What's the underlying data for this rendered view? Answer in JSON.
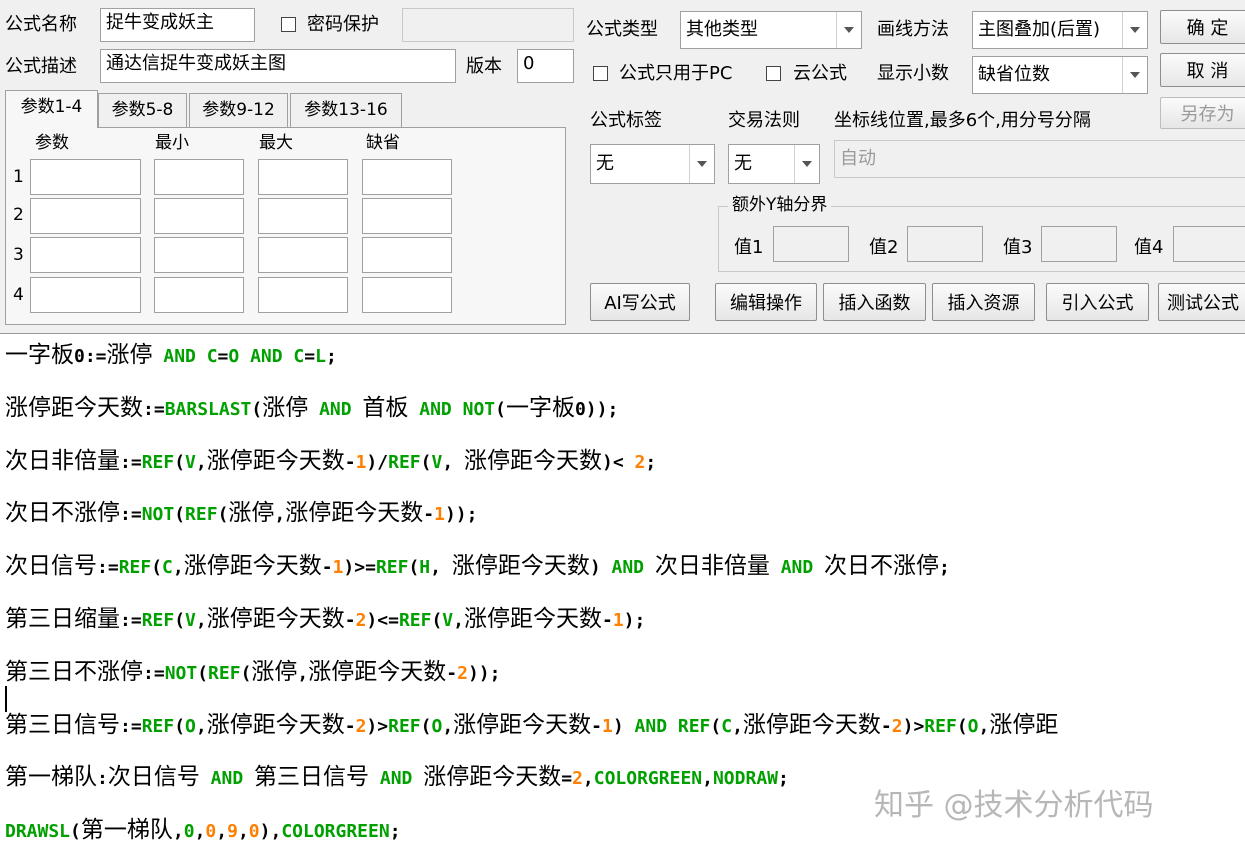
{
  "form": {
    "name_label": "公式名称",
    "name_value": "捉牛变成妖主",
    "pwd_label": "密码保护",
    "desc_label": "公式描述",
    "desc_value": "通达信捉牛变成妖主图",
    "version_label": "版本",
    "version_value": "0",
    "type_label": "公式类型",
    "type_value": "其他类型",
    "draw_label": "画线方法",
    "draw_value": "主图叠加(后置)",
    "pc_only_label": "公式只用于PC",
    "cloud_label": "云公式",
    "decimal_label": "显示小数",
    "decimal_value": "缺省位数",
    "tag_label": "公式标签",
    "tag_value": "无",
    "trade_label": "交易法则",
    "trade_value": "无",
    "axis_label": "坐标线位置,最多6个,用分号分隔",
    "axis_value": "自动",
    "yaxis_group": "额外Y轴分界",
    "v1": "值1",
    "v2": "值2",
    "v3": "值3",
    "v4": "值4"
  },
  "buttons": {
    "ok": "确 定",
    "cancel": "取 消",
    "save_as": "另存为",
    "ai": "AI写公式",
    "edit": "编辑操作",
    "insert_fn": "插入函数",
    "insert_res": "插入资源",
    "import": "引入公式",
    "test": "测试公式"
  },
  "tabs": [
    "参数1-4",
    "参数5-8",
    "参数9-12",
    "参数13-16"
  ],
  "params": {
    "headers": [
      "参数",
      "最小",
      "最大",
      "缺省"
    ],
    "rows": [
      "1",
      "2",
      "3",
      "4"
    ]
  },
  "code": [
    [
      [
        "c",
        "一字板"
      ],
      [
        "o",
        "0:="
      ],
      [
        "c",
        "涨停"
      ],
      [
        "f",
        " AND "
      ],
      [
        "f",
        "C"
      ],
      [
        "o",
        "="
      ],
      [
        "f",
        "O"
      ],
      [
        "f",
        " AND "
      ],
      [
        "f",
        "C"
      ],
      [
        "o",
        "="
      ],
      [
        "f",
        "L"
      ],
      [
        "o",
        ";"
      ]
    ],
    [
      [
        "c",
        "涨停距今天数"
      ],
      [
        "o",
        ":="
      ],
      [
        "f",
        "BARSLAST"
      ],
      [
        "o",
        "("
      ],
      [
        "c",
        "涨停"
      ],
      [
        "f",
        " AND "
      ],
      [
        "c",
        "首板"
      ],
      [
        "f",
        " AND "
      ],
      [
        "f",
        "NOT"
      ],
      [
        "o",
        "("
      ],
      [
        "c",
        "一字板"
      ],
      [
        "o",
        "0));"
      ]
    ],
    [
      [
        "c",
        "次日非倍量"
      ],
      [
        "o",
        ":="
      ],
      [
        "f",
        "REF"
      ],
      [
        "o",
        "("
      ],
      [
        "f",
        "V"
      ],
      [
        "o",
        ","
      ],
      [
        "c",
        "涨停距今天数"
      ],
      [
        "o",
        "-"
      ],
      [
        "n",
        "1"
      ],
      [
        "o",
        ")/"
      ],
      [
        "f",
        "REF"
      ],
      [
        "o",
        "("
      ],
      [
        "f",
        "V"
      ],
      [
        "o",
        ", "
      ],
      [
        "c",
        "涨停距今天数"
      ],
      [
        "o",
        ")< "
      ],
      [
        "n",
        "2"
      ],
      [
        "o",
        ";"
      ]
    ],
    [
      [
        "c",
        "次日不涨停"
      ],
      [
        "o",
        ":="
      ],
      [
        "f",
        "NOT"
      ],
      [
        "o",
        "("
      ],
      [
        "f",
        "REF"
      ],
      [
        "o",
        "("
      ],
      [
        "c",
        "涨停"
      ],
      [
        "o",
        ","
      ],
      [
        "c",
        "涨停距今天数"
      ],
      [
        "o",
        "-"
      ],
      [
        "n",
        "1"
      ],
      [
        "o",
        "));"
      ]
    ],
    [
      [
        "c",
        "次日信号"
      ],
      [
        "o",
        ":="
      ],
      [
        "f",
        "REF"
      ],
      [
        "o",
        "("
      ],
      [
        "f",
        "C"
      ],
      [
        "o",
        ","
      ],
      [
        "c",
        "涨停距今天数"
      ],
      [
        "o",
        "-"
      ],
      [
        "n",
        "1"
      ],
      [
        "o",
        ")>="
      ],
      [
        "f",
        "REF"
      ],
      [
        "o",
        "("
      ],
      [
        "f",
        "H"
      ],
      [
        "o",
        ", "
      ],
      [
        "c",
        "涨停距今天数"
      ],
      [
        "o",
        ")"
      ],
      [
        "f",
        " AND "
      ],
      [
        "c",
        "次日非倍量"
      ],
      [
        "f",
        " AND "
      ],
      [
        "c",
        "次日不涨停"
      ],
      [
        "o",
        ";"
      ]
    ],
    [
      [
        "c",
        "第三日缩量"
      ],
      [
        "o",
        ":="
      ],
      [
        "f",
        "REF"
      ],
      [
        "o",
        "("
      ],
      [
        "f",
        "V"
      ],
      [
        "o",
        ","
      ],
      [
        "c",
        "涨停距今天数"
      ],
      [
        "o",
        "-"
      ],
      [
        "n",
        "2"
      ],
      [
        "o",
        ")<="
      ],
      [
        "f",
        "REF"
      ],
      [
        "o",
        "("
      ],
      [
        "f",
        "V"
      ],
      [
        "o",
        ","
      ],
      [
        "c",
        "涨停距今天数"
      ],
      [
        "o",
        "-"
      ],
      [
        "n",
        "1"
      ],
      [
        "o",
        ");"
      ]
    ],
    [
      [
        "c",
        "第三日不涨停"
      ],
      [
        "o",
        ":="
      ],
      [
        "f",
        "NOT"
      ],
      [
        "o",
        "("
      ],
      [
        "f",
        "REF"
      ],
      [
        "o",
        "("
      ],
      [
        "c",
        "涨停"
      ],
      [
        "o",
        ","
      ],
      [
        "c",
        "涨停距今天数"
      ],
      [
        "o",
        "-"
      ],
      [
        "n",
        "2"
      ],
      [
        "o",
        "));"
      ]
    ],
    [
      [
        "c",
        "第三日信号"
      ],
      [
        "o",
        ":="
      ],
      [
        "f",
        "REF"
      ],
      [
        "o",
        "("
      ],
      [
        "f",
        "O"
      ],
      [
        "o",
        ","
      ],
      [
        "c",
        "涨停距今天数"
      ],
      [
        "o",
        "-"
      ],
      [
        "n",
        "2"
      ],
      [
        "o",
        ")>"
      ],
      [
        "f",
        "REF"
      ],
      [
        "o",
        "("
      ],
      [
        "f",
        "O"
      ],
      [
        "o",
        ","
      ],
      [
        "c",
        "涨停距今天数"
      ],
      [
        "o",
        "-"
      ],
      [
        "n",
        "1"
      ],
      [
        "o",
        ")"
      ],
      [
        "f",
        " AND "
      ],
      [
        "f",
        "REF"
      ],
      [
        "o",
        "("
      ],
      [
        "f",
        "C"
      ],
      [
        "o",
        ","
      ],
      [
        "c",
        "涨停距今天数"
      ],
      [
        "o",
        "-"
      ],
      [
        "n",
        "2"
      ],
      [
        "o",
        ")>"
      ],
      [
        "f",
        "REF"
      ],
      [
        "o",
        "("
      ],
      [
        "f",
        "O"
      ],
      [
        "o",
        ","
      ],
      [
        "c",
        "涨停距"
      ]
    ],
    [
      [
        "c",
        "第一梯队"
      ],
      [
        "o",
        ":"
      ],
      [
        "c",
        "次日信号"
      ],
      [
        "f",
        " AND "
      ],
      [
        "c",
        "第三日信号"
      ],
      [
        "f",
        " AND "
      ],
      [
        "c",
        "涨停距今天数"
      ],
      [
        "o",
        "="
      ],
      [
        "n",
        "2"
      ],
      [
        "o",
        ","
      ],
      [
        "f",
        "COLORGREEN"
      ],
      [
        "o",
        ","
      ],
      [
        "f",
        "NODRAW"
      ],
      [
        "o",
        ";"
      ]
    ],
    [
      [
        "f",
        "DRAWSL"
      ],
      [
        "o",
        "("
      ],
      [
        "c",
        "第一梯队"
      ],
      [
        "o",
        ","
      ],
      [
        "f",
        "0"
      ],
      [
        "o",
        ","
      ],
      [
        "n",
        "0"
      ],
      [
        "o",
        ","
      ],
      [
        "n",
        "9"
      ],
      [
        "o",
        ","
      ],
      [
        "n",
        "0"
      ],
      [
        "o",
        "),"
      ],
      [
        "f",
        "COLORGREEN"
      ],
      [
        "o",
        ";"
      ]
    ]
  ],
  "watermark": "知乎 @技术分析代码"
}
